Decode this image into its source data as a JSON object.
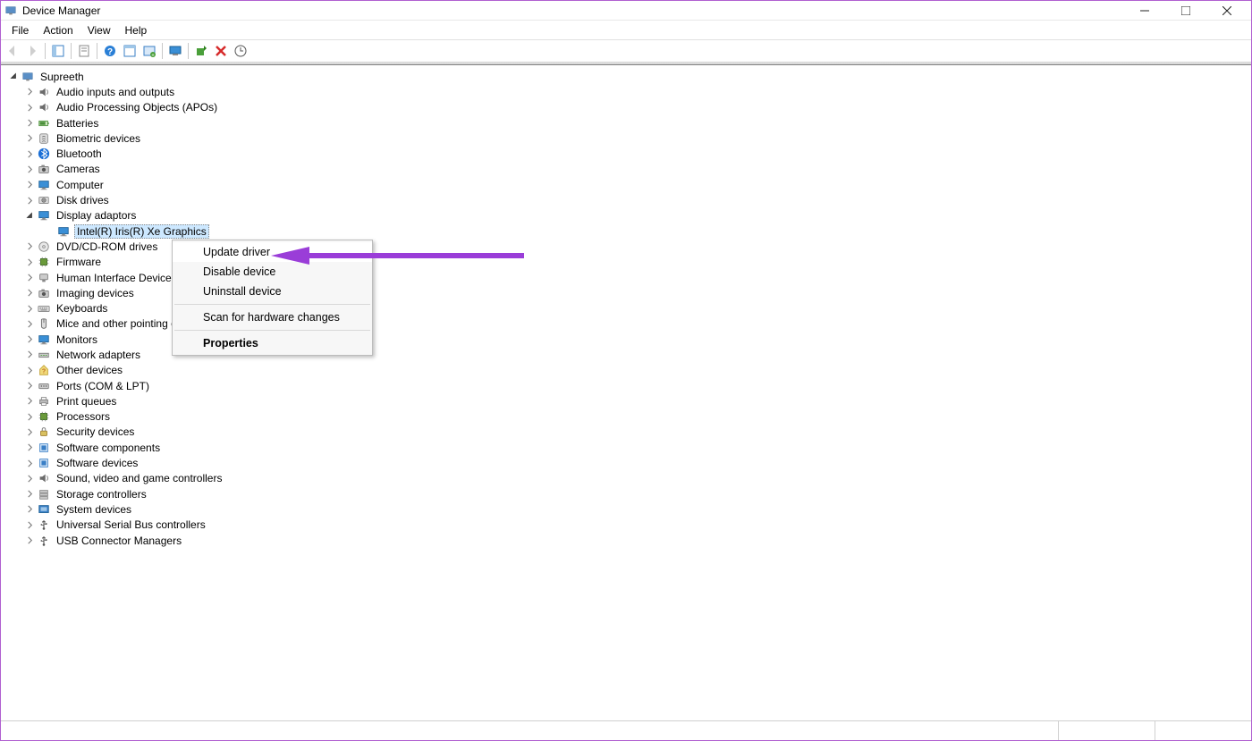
{
  "window": {
    "title": "Device Manager",
    "minimize": "Minimize",
    "maximize": "Maximize",
    "close": "Close"
  },
  "menubar": {
    "file": "File",
    "action": "Action",
    "view": "View",
    "help": "Help"
  },
  "toolbar": {
    "back": "Back",
    "forward": "Forward",
    "show_hide": "Show/Hide Console Tree",
    "properties": "Properties",
    "help": "Help",
    "refresh": "Refresh",
    "scan": "Scan for hardware changes",
    "computer": "Computer",
    "add_legacy": "Add legacy hardware",
    "remove": "Uninstall device",
    "options": "Options"
  },
  "tree": {
    "root": "Supreeth",
    "categories": [
      {
        "label": "Audio inputs and outputs",
        "icon": "speaker"
      },
      {
        "label": "Audio Processing Objects (APOs)",
        "icon": "speaker"
      },
      {
        "label": "Batteries",
        "icon": "battery"
      },
      {
        "label": "Biometric devices",
        "icon": "fingerprint"
      },
      {
        "label": "Bluetooth",
        "icon": "bluetooth"
      },
      {
        "label": "Cameras",
        "icon": "camera"
      },
      {
        "label": "Computer",
        "icon": "monitor"
      },
      {
        "label": "Disk drives",
        "icon": "drive"
      },
      {
        "label": "Display adaptors",
        "icon": "monitor",
        "expanded": true,
        "children": [
          {
            "label": "Intel(R) Iris(R) Xe Graphics",
            "icon": "monitor",
            "selected": true
          }
        ]
      },
      {
        "label": "DVD/CD-ROM drives",
        "icon": "disc"
      },
      {
        "label": "Firmware",
        "icon": "chip"
      },
      {
        "label": "Human Interface Devices",
        "icon": "hid"
      },
      {
        "label": "Imaging devices",
        "icon": "camera"
      },
      {
        "label": "Keyboards",
        "icon": "keyboard"
      },
      {
        "label": "Mice and other pointing devices",
        "icon": "mouse",
        "clipped": "Mice and other pointing c"
      },
      {
        "label": "Monitors",
        "icon": "monitor"
      },
      {
        "label": "Network adapters",
        "icon": "network"
      },
      {
        "label": "Other devices",
        "icon": "other"
      },
      {
        "label": "Ports (COM & LPT)",
        "icon": "port"
      },
      {
        "label": "Print queues",
        "icon": "printer"
      },
      {
        "label": "Processors",
        "icon": "chip"
      },
      {
        "label": "Security devices",
        "icon": "lock"
      },
      {
        "label": "Software components",
        "icon": "component"
      },
      {
        "label": "Software devices",
        "icon": "component"
      },
      {
        "label": "Sound, video and game controllers",
        "icon": "speaker"
      },
      {
        "label": "Storage controllers",
        "icon": "storage"
      },
      {
        "label": "System devices",
        "icon": "system"
      },
      {
        "label": "Universal Serial Bus controllers",
        "icon": "usb"
      },
      {
        "label": "USB Connector Managers",
        "icon": "usb"
      }
    ]
  },
  "context_menu": {
    "update_driver": "Update driver",
    "disable_device": "Disable device",
    "uninstall_device": "Uninstall device",
    "scan_hardware": "Scan for hardware changes",
    "properties": "Properties"
  },
  "annotation": {
    "arrow_color": "#9a3dd8"
  },
  "icon_colors": {
    "speaker": "#6b6b6b",
    "battery": "#4a8f3a",
    "bluetooth": "#1a6fd6",
    "monitor": "#2a7fd6",
    "drive": "#888",
    "chip": "#6a9a3a",
    "mouse": "#666",
    "network": "#777",
    "usb": "#555",
    "other": "#c0a030",
    "system": "#3a7fc6"
  }
}
